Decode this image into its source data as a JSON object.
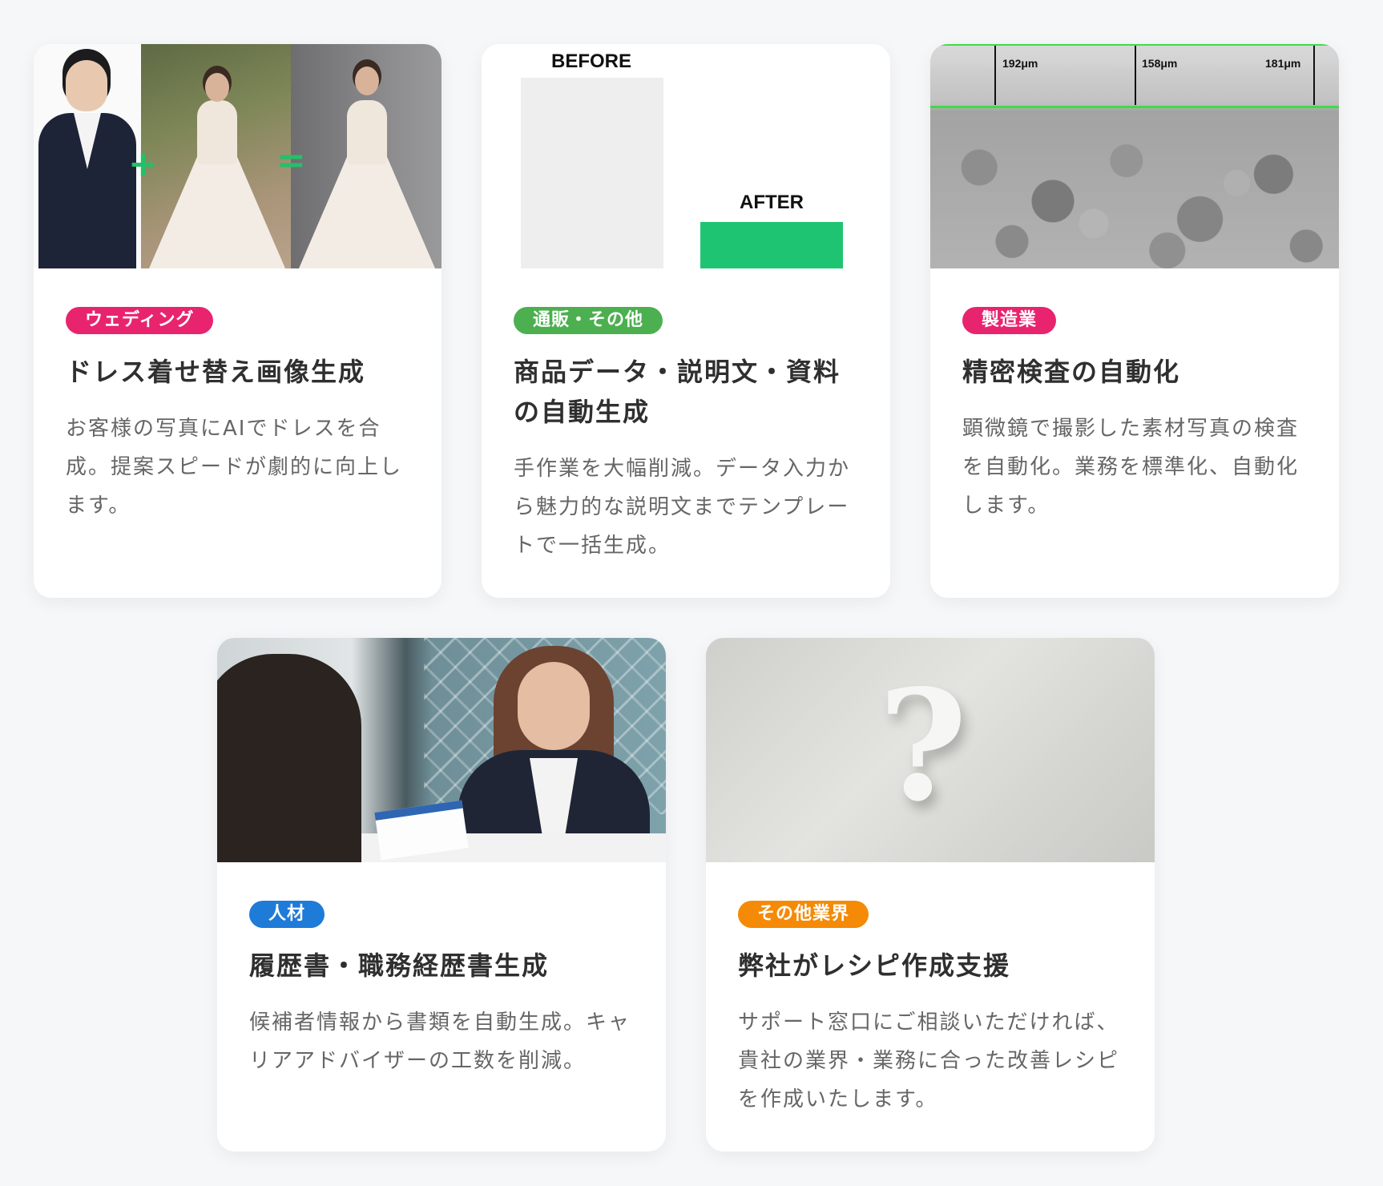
{
  "cards": [
    {
      "tag": "ウェディング",
      "tag_color": "#e8246f",
      "title": "ドレス着せ替え画像生成",
      "desc": "お客様の写真にAIでドレスを合成。提案スピードが劇的に向上します。",
      "image": {
        "plus": "+",
        "equals": "="
      }
    },
    {
      "tag": "通販・その他",
      "tag_color": "#4caf50",
      "title": "商品データ・説明文・資料の自動生成",
      "desc": "手作業を大幅削減。データ入力から魅力的な説明文までテンプレートで一括生成。",
      "image": {
        "before": "BEFORE",
        "after": "AFTER",
        "after_color": "#1fc472"
      }
    },
    {
      "tag": "製造業",
      "tag_color": "#e8246f",
      "title": "精密検査の自動化",
      "desc": "顕微鏡で撮影した素材写真の検査を自動化。業務を標準化、自動化します。",
      "image": {
        "measurements": [
          "192μm",
          "158μm",
          "181μm"
        ],
        "line_color": "#3ddc4a"
      }
    },
    {
      "tag": "人材",
      "tag_color": "#1f7bd8",
      "title": "履歴書・職務経歴書生成",
      "desc": "候補者情報から書類を自動生成。キャリアアドバイザーの工数を削減。"
    },
    {
      "tag": "その他業界",
      "tag_color": "#f58a07",
      "title": "弊社がレシピ作成支援",
      "desc": "サポート窓口にご相談いただければ、貴社の業界・業務に合った改善レシピを作成いたします。",
      "image": {
        "symbol": "?"
      }
    }
  ]
}
